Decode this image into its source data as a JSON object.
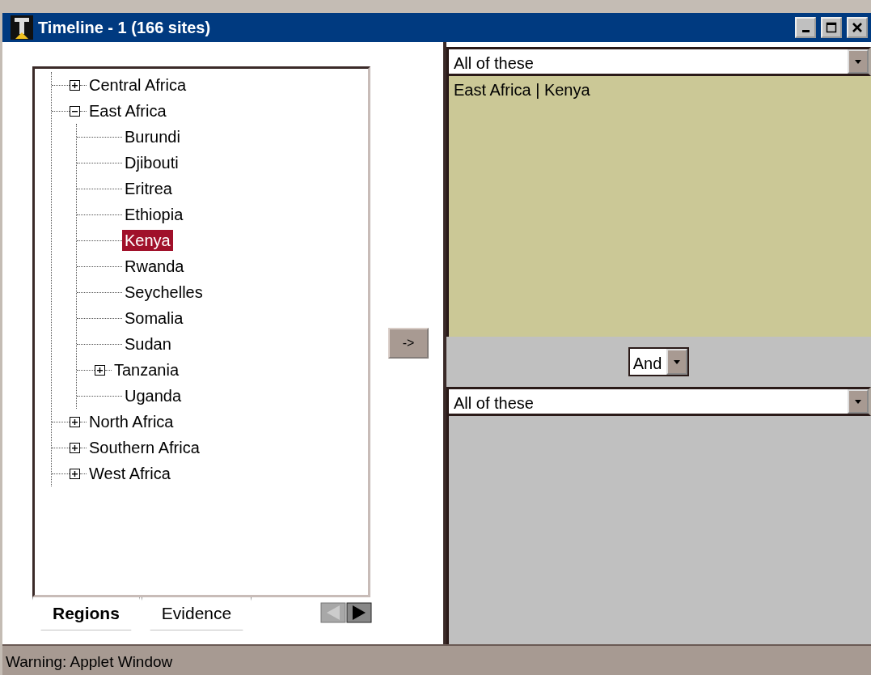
{
  "window": {
    "title": "Timeline - 1 (166 sites)"
  },
  "tree": [
    {
      "label": "Central Africa",
      "expanded": false,
      "selected": false
    },
    {
      "label": "East Africa",
      "expanded": true,
      "selected": false,
      "children": [
        {
          "label": "Burundi",
          "selected": false
        },
        {
          "label": "Djibouti",
          "selected": false
        },
        {
          "label": "Eritrea",
          "selected": false
        },
        {
          "label": "Ethiopia",
          "selected": false
        },
        {
          "label": "Kenya",
          "selected": true
        },
        {
          "label": "Rwanda",
          "selected": false
        },
        {
          "label": "Seychelles",
          "selected": false
        },
        {
          "label": "Somalia",
          "selected": false
        },
        {
          "label": "Sudan",
          "selected": false
        },
        {
          "label": "Tanzania",
          "expanded": false,
          "selected": false
        },
        {
          "label": "Uganda",
          "selected": false
        }
      ]
    },
    {
      "label": "North Africa",
      "expanded": false,
      "selected": false
    },
    {
      "label": "Southern Africa",
      "expanded": false,
      "selected": false
    },
    {
      "label": "West Africa",
      "expanded": false,
      "selected": false
    }
  ],
  "tabs": [
    {
      "label": "Regions",
      "selected": true
    },
    {
      "label": "Evidence",
      "selected": false
    }
  ],
  "add_button": "->",
  "top_filter": {
    "mode": "All of these",
    "items": [
      "East Africa | Kenya"
    ]
  },
  "combinator": "And",
  "bottom_filter": {
    "mode": "All of these"
  },
  "status_bar": "Warning: Applet Window"
}
